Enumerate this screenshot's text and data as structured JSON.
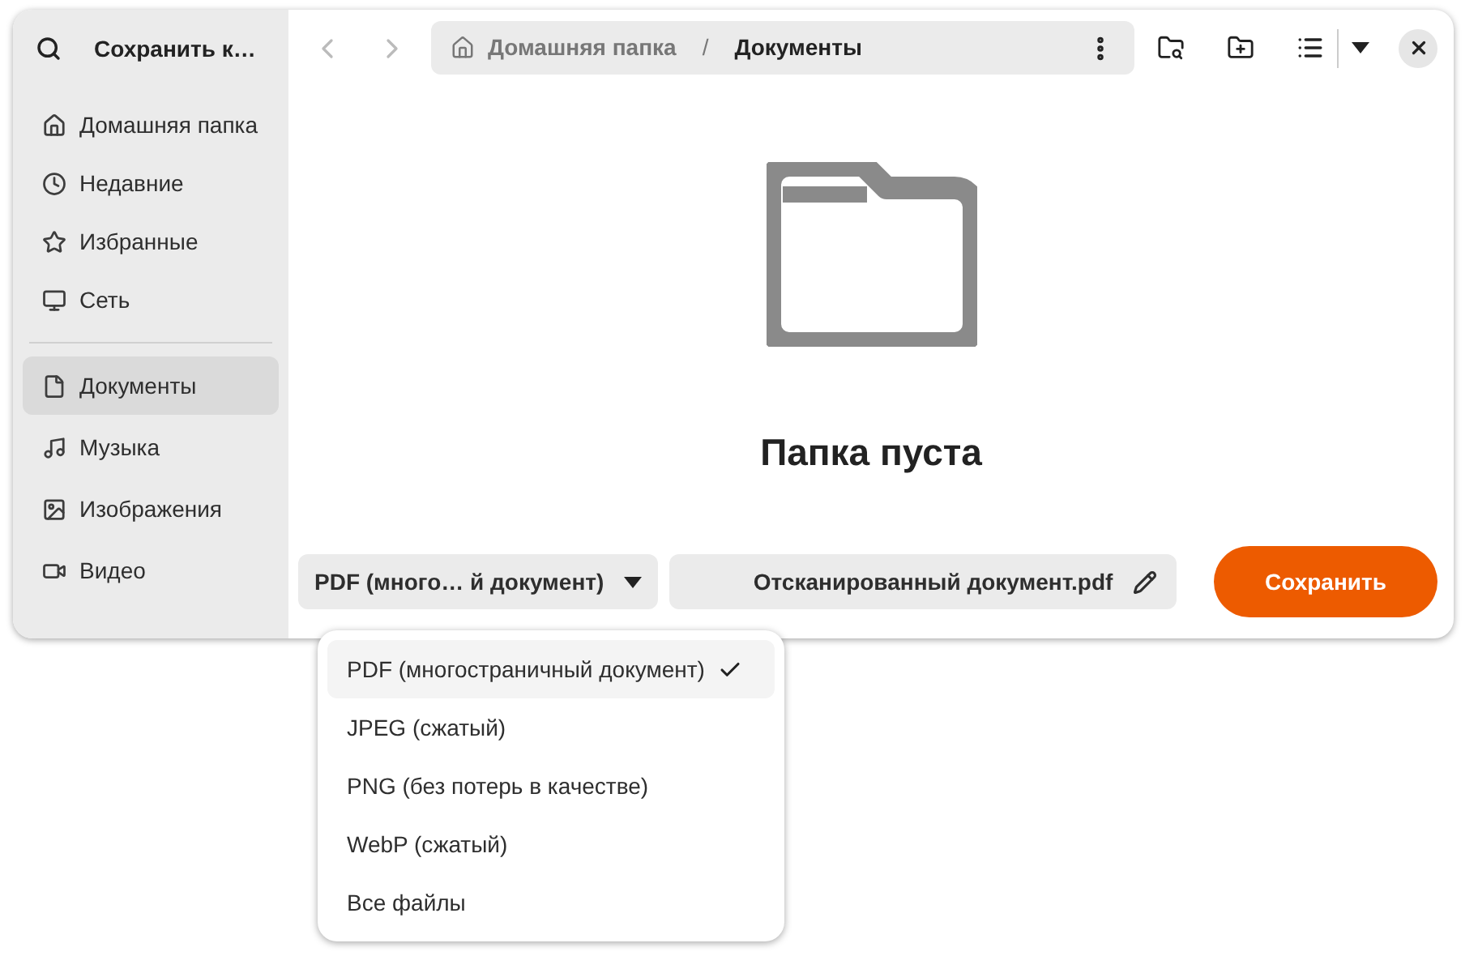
{
  "sidebar": {
    "title": "Сохранить к…",
    "places": [
      {
        "label": "Домашняя папка",
        "selected": false
      },
      {
        "label": "Недавние",
        "selected": false
      },
      {
        "label": "Избранные",
        "selected": false
      },
      {
        "label": "Сеть",
        "selected": false
      }
    ],
    "bookmarks": [
      {
        "label": "Документы",
        "selected": true
      },
      {
        "label": "Музыка",
        "selected": false
      },
      {
        "label": "Изображения",
        "selected": false
      },
      {
        "label": "Видео",
        "selected": false
      }
    ]
  },
  "path_bar": {
    "segments": [
      {
        "label": "Домашняя папка",
        "selected": false
      },
      {
        "label": "Документы",
        "selected": true
      }
    ],
    "separator": "/"
  },
  "empty_state": {
    "title": "Папка пуста"
  },
  "footer": {
    "filter": "PDF (много… й документ)",
    "filename": "Отсканированный документ.pdf",
    "save_button": "Сохранить"
  },
  "filter_menu": [
    {
      "label": "PDF (многостраничный документ)",
      "selected": true
    },
    {
      "label": "JPEG (сжатый)",
      "selected": false
    },
    {
      "label": "PNG (без потерь в качестве)",
      "selected": false
    },
    {
      "label": "WebP (сжатый)",
      "selected": false
    },
    {
      "label": "Все файлы",
      "selected": false
    }
  ]
}
